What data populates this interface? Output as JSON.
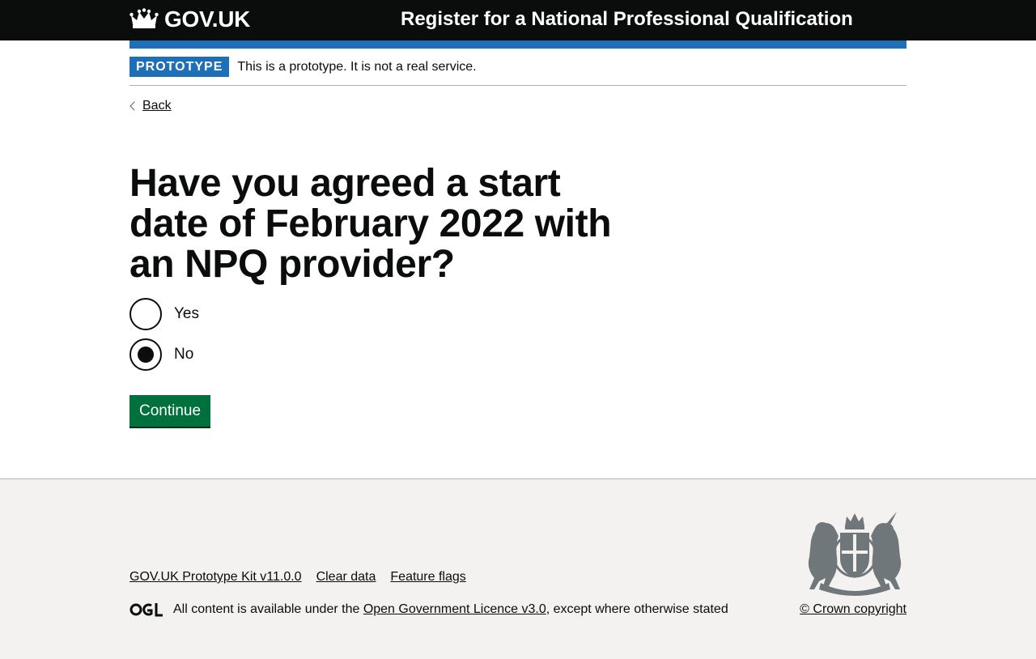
{
  "header": {
    "logo_text": "GOV.UK",
    "service_name": "Register for a National Professional Qualification"
  },
  "phase_banner": {
    "tag": "PROTOTYPE",
    "text": "This is a prototype. It is not a real service."
  },
  "back_link": "Back",
  "question": {
    "title": "Have you agreed a start date of February 2022 with an NPQ provider?",
    "options": [
      {
        "label": "Yes",
        "checked": false
      },
      {
        "label": "No",
        "checked": true
      }
    ]
  },
  "continue_button": "Continue",
  "footer": {
    "links": [
      "GOV.UK Prototype Kit v11.0.0",
      "Clear data",
      "Feature flags"
    ],
    "licence_prefix": "All content is available under the ",
    "licence_link": "Open Government Licence v3.0",
    "licence_suffix": ", except where otherwise stated",
    "copyright": "© Crown copyright"
  },
  "colors": {
    "header_bg": "#0b0c0c",
    "brand_blue": "#1d70b8",
    "button_green": "#00703c",
    "footer_bg": "#f3f2f1"
  },
  "icons": [
    "crown-icon",
    "chevron-left-icon",
    "ogl-logo-icon",
    "royal-crest-icon"
  ]
}
